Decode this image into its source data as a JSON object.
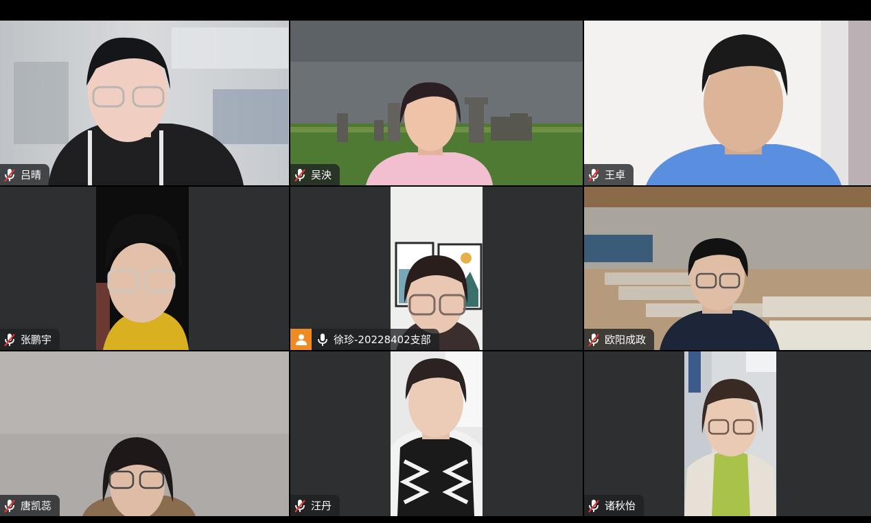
{
  "participants": [
    {
      "name": "吕晴",
      "mic": "muted"
    },
    {
      "name": "吴泱",
      "mic": "muted"
    },
    {
      "name": "王卓",
      "mic": "muted"
    },
    {
      "name": "张鹏宇",
      "mic": "muted"
    },
    {
      "name": "徐珍-20228402支部",
      "mic": "unmuted",
      "avatar": "person-icon"
    },
    {
      "name": "欧阳成政",
      "mic": "muted"
    },
    {
      "name": "唐凯蕊",
      "mic": "muted"
    },
    {
      "name": "汪丹",
      "mic": "muted"
    },
    {
      "name": "诸秋怡",
      "mic": "muted"
    }
  ],
  "colors": {
    "tile_background": "#2d2f31",
    "avatar_badge": "#f08a24",
    "muted_icon": "#ffffff"
  }
}
